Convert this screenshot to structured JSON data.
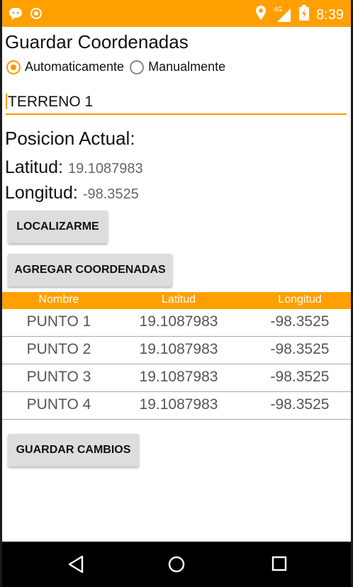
{
  "status_bar": {
    "time": "8:39",
    "network": "4G"
  },
  "app": {
    "title": "Guardar Coordenadas"
  },
  "mode": {
    "options": [
      {
        "label": "Automaticamente",
        "selected": true
      },
      {
        "label": "Manualmente",
        "selected": false
      }
    ]
  },
  "terrain_name": {
    "value": "TERRENO 1"
  },
  "position": {
    "heading": "Posicion Actual:",
    "lat_label": "Latitud:",
    "lat_value": "19.1087983",
    "lon_label": "Longitud:",
    "lon_value": "-98.3525"
  },
  "buttons": {
    "locate": "LOCALIZARME",
    "add": "AGREGAR COORDENADAS",
    "save": "GUARDAR CAMBIOS"
  },
  "table": {
    "headers": [
      "Nombre",
      "Latitud",
      "Longitud"
    ],
    "rows": [
      [
        "PUNTO 1",
        "19.1087983",
        "-98.3525"
      ],
      [
        "PUNTO 2",
        "19.1087983",
        "-98.3525"
      ],
      [
        "PUNTO 3",
        "19.1087983",
        "-98.3525"
      ],
      [
        "PUNTO 4",
        "19.1087983",
        "-98.3525"
      ]
    ]
  },
  "colors": {
    "accent": "#ff9800",
    "status_bar": "#ffa000",
    "button": "#dddddd"
  },
  "icons": [
    "chat-icon",
    "shield-icon",
    "location-pin-icon",
    "signal-icon",
    "battery-icon",
    "back-icon",
    "home-icon",
    "recents-icon"
  ]
}
